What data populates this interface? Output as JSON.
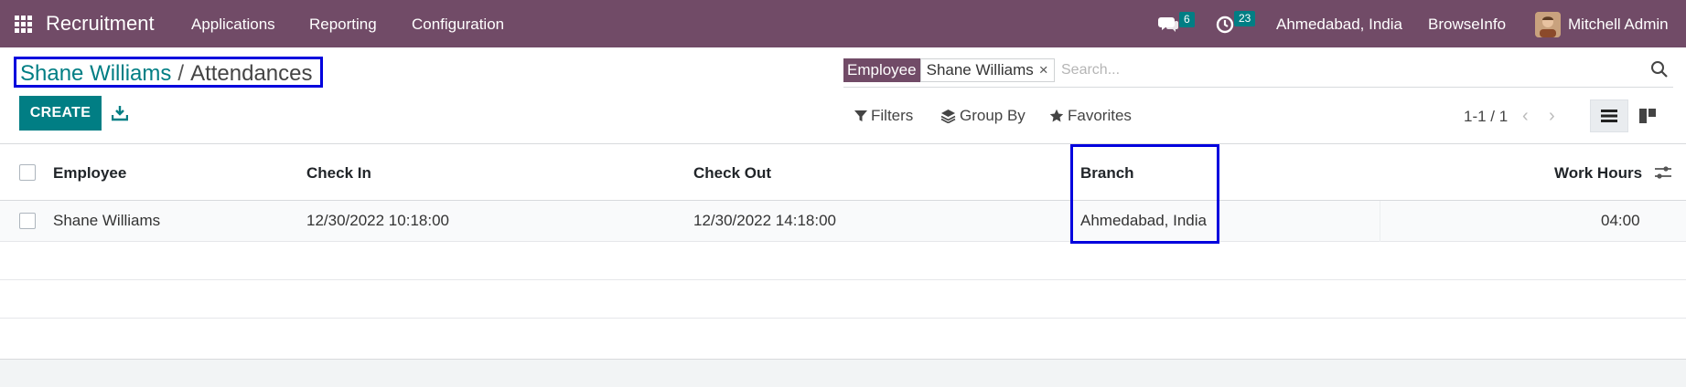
{
  "navbar": {
    "app_name": "Recruitment",
    "menu": [
      "Applications",
      "Reporting",
      "Configuration"
    ],
    "messages_count": "6",
    "activities_count": "23",
    "company": "Ahmedabad, India",
    "company2": "BrowseInfo",
    "user": "Mitchell Admin"
  },
  "breadcrumb": {
    "parent": "Shane Williams",
    "separator": "/",
    "current": "Attendances"
  },
  "search": {
    "facet_label": "Employee",
    "facet_value": "Shane Williams",
    "facet_remove": "×",
    "placeholder": "Search..."
  },
  "toolbar": {
    "create_label": "CREATE",
    "filters_label": "Filters",
    "groupby_label": "Group By",
    "favorites_label": "Favorites",
    "pager": "1-1 / 1"
  },
  "table": {
    "columns": {
      "employee": "Employee",
      "check_in": "Check In",
      "check_out": "Check Out",
      "branch": "Branch",
      "work_hours": "Work Hours"
    },
    "rows": [
      {
        "employee": "Shane Williams",
        "check_in": "12/30/2022 10:18:00",
        "check_out": "12/30/2022 14:18:00",
        "branch": "Ahmedabad, India",
        "work_hours": "04:00"
      }
    ]
  },
  "colors": {
    "brand": "#714b67",
    "primary": "#017e84",
    "highlight": "#0000dd"
  }
}
